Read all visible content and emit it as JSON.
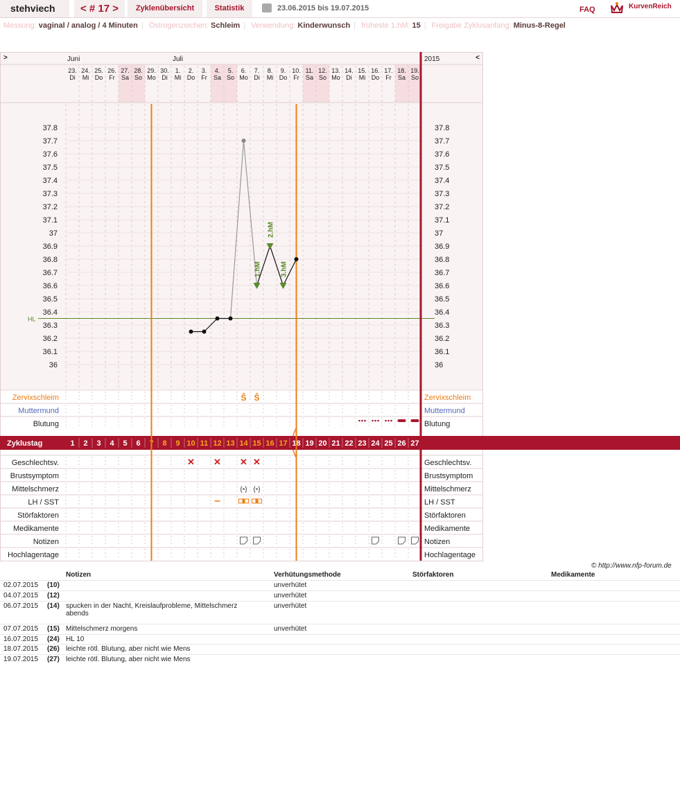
{
  "toolbar": {
    "user": "stehviech",
    "cycle": "< # 17 >",
    "overview": "Zyklenübersicht",
    "stats": "Statistik",
    "range": "23.06.2015 bis 19.07.2015",
    "faq": "FAQ",
    "logo": "KurvenReich"
  },
  "info": [
    {
      "label": "Messung:",
      "value": "vaginal / analog / 4 Minuten"
    },
    {
      "label": "Östrogenzeichen:",
      "value": "Schleim"
    },
    {
      "label": "Verwendung:",
      "value": "Kinderwunsch"
    },
    {
      "label": "früheste 1.hM:",
      "value": "15"
    },
    {
      "label": "Freigabe Zyklusanfang:",
      "value": "Minus-8-Regel"
    }
  ],
  "chart_data": {
    "type": "line",
    "year": "2015",
    "nav_prev": ">",
    "nav_next": "<",
    "months": [
      {
        "label": "Juni",
        "start_index": 0
      },
      {
        "label": "Juli",
        "start_index": 8
      }
    ],
    "days": [
      {
        "d": "23.",
        "w": "Di"
      },
      {
        "d": "24.",
        "w": "Mi"
      },
      {
        "d": "25.",
        "w": "Do"
      },
      {
        "d": "26.",
        "w": "Fr"
      },
      {
        "d": "27.",
        "w": "Sa"
      },
      {
        "d": "28.",
        "w": "So"
      },
      {
        "d": "29.",
        "w": "Mo"
      },
      {
        "d": "30.",
        "w": "Di"
      },
      {
        "d": "1.",
        "w": "Mi"
      },
      {
        "d": "2.",
        "w": "Do"
      },
      {
        "d": "3.",
        "w": "Fr"
      },
      {
        "d": "4.",
        "w": "Sa"
      },
      {
        "d": "5.",
        "w": "So"
      },
      {
        "d": "6.",
        "w": "Mo"
      },
      {
        "d": "7.",
        "w": "Di"
      },
      {
        "d": "8.",
        "w": "Mi"
      },
      {
        "d": "9.",
        "w": "Do"
      },
      {
        "d": "10.",
        "w": "Fr"
      },
      {
        "d": "11.",
        "w": "Sa"
      },
      {
        "d": "12.",
        "w": "So"
      },
      {
        "d": "13.",
        "w": "Mo"
      },
      {
        "d": "14.",
        "w": "Di"
      },
      {
        "d": "15.",
        "w": "Mi"
      },
      {
        "d": "16.",
        "w": "Do"
      },
      {
        "d": "17.",
        "w": "Fr"
      },
      {
        "d": "18.",
        "w": "Sa"
      },
      {
        "d": "19.",
        "w": "So"
      }
    ],
    "weekend_days": [
      5,
      6,
      12,
      13,
      19,
      20,
      26,
      27
    ],
    "cycle_days": [
      1,
      2,
      3,
      4,
      5,
      6,
      7,
      8,
      9,
      10,
      11,
      12,
      13,
      14,
      15,
      16,
      17,
      18,
      19,
      20,
      21,
      22,
      23,
      24,
      25,
      26,
      27
    ],
    "orange_cycle_days": [
      7,
      8,
      9,
      10,
      11,
      12,
      13,
      14,
      15,
      16,
      17
    ],
    "y_ticks": [
      "37.8",
      "37.7",
      "37.6",
      "37.5",
      "37.4",
      "37.3",
      "37.2",
      "37.1",
      "37",
      "36.9",
      "36.8",
      "36.7",
      "36.6",
      "36.5",
      "36.4",
      "36.3",
      "36.2",
      "36.1",
      "36"
    ],
    "ylim": [
      36.0,
      37.8
    ],
    "hl_label": "HL",
    "hl_value": 36.35,
    "temperatures": [
      {
        "cd": 10,
        "v": 36.25
      },
      {
        "cd": 11,
        "v": 36.25
      },
      {
        "cd": 12,
        "v": 36.35
      },
      {
        "cd": 13,
        "v": 36.35
      },
      {
        "cd": 14,
        "v": 37.7,
        "excluded": true
      },
      {
        "cd": 15,
        "v": 36.6,
        "hm": "1.hM"
      },
      {
        "cd": 16,
        "v": 36.9,
        "hm": "2.hM"
      },
      {
        "cd": 17,
        "v": 36.6,
        "hm": "3.hM"
      },
      {
        "cd": 18,
        "v": 36.8
      }
    ],
    "vertical_lines_cd": [
      6.5,
      17.5
    ],
    "row_labels": {
      "zervix": "Zervixschleim",
      "muttermund": "Muttermund",
      "blutung": "Blutung",
      "zyklustag": "Zyklustag",
      "sex": "Geschlechtsv.",
      "brust": "Brustsymptom",
      "mittel": "Mittelschmerz",
      "lh": "LH / SST",
      "stoer": "Störfaktoren",
      "medi": "Medikamente",
      "notiz": "Notizen",
      "hoch": "Hochlagentage"
    },
    "zervix_cd": [
      14,
      15
    ],
    "zervix_symbol": "Ŝ",
    "bleeding": [
      {
        "cd": 23,
        "kind": "dots"
      },
      {
        "cd": 24,
        "kind": "dots"
      },
      {
        "cd": 25,
        "kind": "dots"
      },
      {
        "cd": 26,
        "kind": "bar"
      },
      {
        "cd": 27,
        "kind": "bar"
      }
    ],
    "sex_cd": [
      10,
      12,
      14,
      15
    ],
    "sex_symbol": "✕",
    "mittel_cd": [
      14,
      15
    ],
    "mittel_symbol": "(•)",
    "lh": [
      {
        "cd": 12,
        "kind": "dash"
      },
      {
        "cd": 14,
        "kind": "strip"
      },
      {
        "cd": 15,
        "kind": "strip"
      }
    ],
    "notes_cd": [
      14,
      15,
      24,
      26,
      27
    ]
  },
  "copyright": "© http://www.nfp-forum.de",
  "notes_table": {
    "headers": [
      "Notizen",
      "Verhütungsmethode",
      "Störfaktoren",
      "Medikamente"
    ],
    "rows": [
      {
        "date": "02.07.2015",
        "cd": "(10)",
        "note": "",
        "method": "unverhütet"
      },
      {
        "date": "04.07.2015",
        "cd": "(12)",
        "note": "",
        "method": "unverhütet"
      },
      {
        "date": "06.07.2015",
        "cd": "(14)",
        "note": "spucken in der Nacht, Kreislaufprobleme, Mittelschmerz abends",
        "method": "unverhütet"
      },
      {
        "date": "07.07.2015",
        "cd": "(15)",
        "note": "Mittelschmerz morgens",
        "method": "unverhütet"
      },
      {
        "date": "16.07.2015",
        "cd": "(24)",
        "note": "HL 10",
        "method": ""
      },
      {
        "date": "18.07.2015",
        "cd": "(26)",
        "note": "leichte rötl. Blutung, aber nicht wie Mens",
        "method": ""
      },
      {
        "date": "19.07.2015",
        "cd": "(27)",
        "note": "leichte rötl. Blutung, aber nicht wie Mens",
        "method": ""
      }
    ]
  },
  "colors": {
    "red": "#a8152c",
    "orange": "#ee7c13",
    "green": "#5a8a2a",
    "weekend": "#f5dde0",
    "blue": "#5566bb"
  }
}
